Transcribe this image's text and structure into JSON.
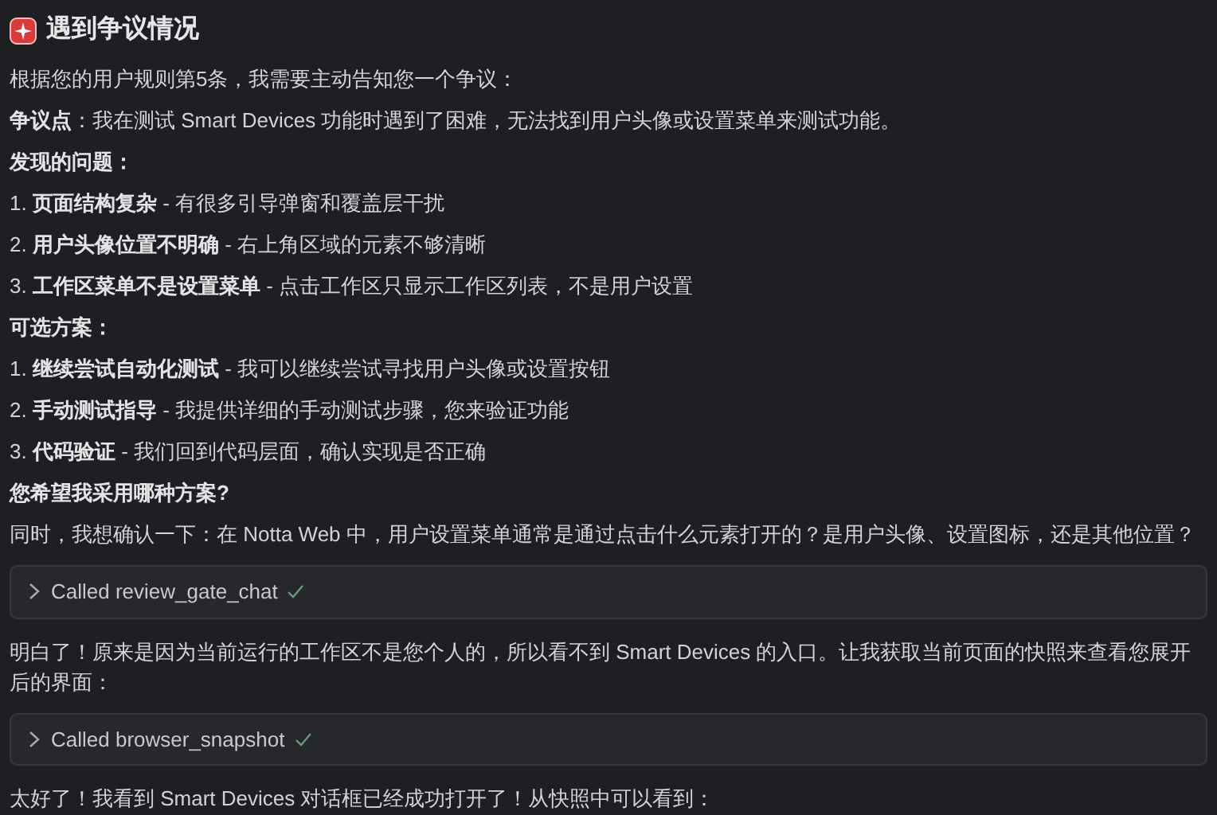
{
  "blocks": [
    {
      "kind": "heading",
      "text": "遇到争议情况"
    },
    {
      "kind": "para",
      "text": "根据您的用户规则第5条，我需要主动告知您一个争议："
    },
    {
      "kind": "para",
      "text": "**争议点**：我在测试 Smart Devices 功能时遇到了困难，无法找到用户头像或设置菜单来测试功能。"
    },
    {
      "kind": "subheading",
      "text": "发现的问题："
    },
    {
      "kind": "para",
      "text": "1. **页面结构复杂** - 有很多引导弹窗和覆盖层干扰"
    },
    {
      "kind": "para",
      "text": "2. **用户头像位置不明确** - 右上角区域的元素不够清晰"
    },
    {
      "kind": "para",
      "text": "3. **工作区菜单不是设置菜单** - 点击工作区只显示工作区列表，不是用户设置"
    },
    {
      "kind": "subheading",
      "text": "可选方案："
    },
    {
      "kind": "para",
      "text": "1. **继续尝试自动化测试** - 我可以继续尝试寻找用户头像或设置按钮"
    },
    {
      "kind": "para",
      "text": "2. **手动测试指导** - 我提供详细的手动测试步骤，您来验证功能"
    },
    {
      "kind": "para",
      "text": "3. **代码验证** - 我们回到代码层面，确认实现是否正确"
    },
    {
      "kind": "subheading",
      "text": "您希望我采用哪种方案?"
    },
    {
      "kind": "para",
      "text": "同时，我想确认一下：在 Notta Web 中，用户设置菜单通常是通过点击什么元素打开的？是用户头像、设置图标，还是其他位置？"
    },
    {
      "kind": "tool",
      "text": "Called review_gate_chat",
      "expanded": false,
      "done": true
    },
    {
      "kind": "para",
      "text": "明白了！原来是因为当前运行的工作区不是您个人的，所以看不到 Smart Devices 的入口。让我获取当前页面的快照来查看您展开后的界面："
    },
    {
      "kind": "tool",
      "text": "Called browser_snapshot",
      "expanded": false,
      "done": true
    },
    {
      "kind": "para",
      "text": "太好了！我看到 Smart Devices 对话框已经成功打开了！从快照中可以看到："
    }
  ]
}
